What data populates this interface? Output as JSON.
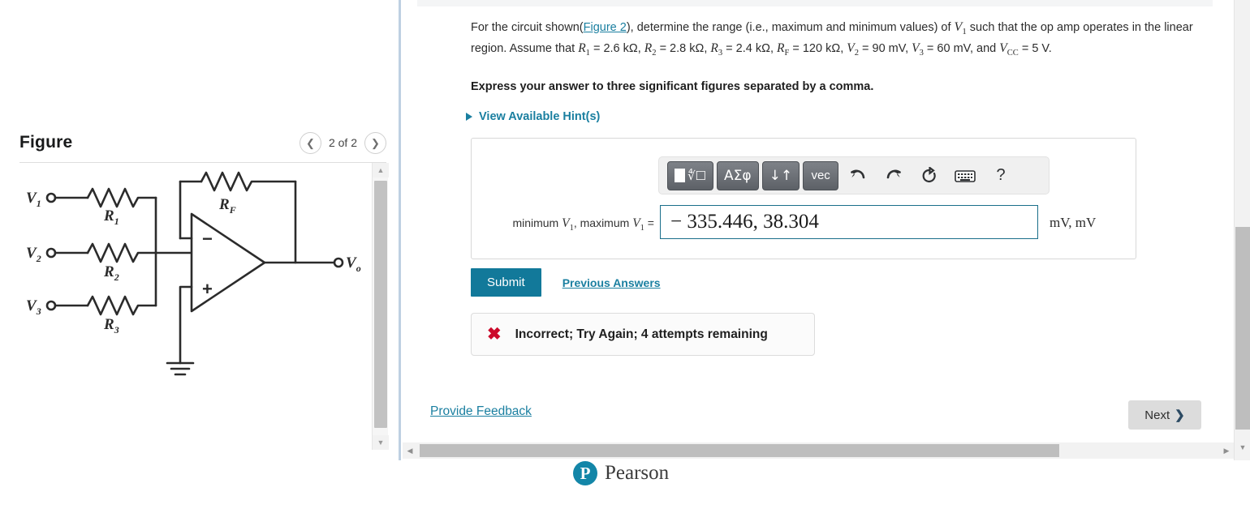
{
  "figure_panel": {
    "title": "Figure",
    "nav": {
      "prev_icon": "chevron-left-icon",
      "count": "2 of 2",
      "next_icon": "chevron-right-icon"
    },
    "circuit": {
      "alt": "summing op-amp circuit",
      "inputs": [
        "V1",
        "V2",
        "V3"
      ],
      "resistors": [
        "R1",
        "R2",
        "R3",
        "RF"
      ],
      "output": "Vo",
      "opamp_minus": "−",
      "opamp_plus": "+"
    }
  },
  "question": {
    "line1_a": "For the circuit shown(",
    "figure_link": "Figure 2",
    "line1_b": "), determine the range (i.e., maximum and minimum values) of ",
    "v1": "V",
    "v1_sub": "1",
    "line1_c": " such that the op amp operates in the linear region. Assume that ",
    "givens": [
      {
        "sym": "R",
        "sub": "1",
        "val": "= 2.6 kΩ"
      },
      {
        "sym": "R",
        "sub": "2",
        "val": "= 2.8 kΩ"
      },
      {
        "sym": "R",
        "sub": "3",
        "val": "= 2.4 kΩ"
      },
      {
        "sym": "R",
        "sub": "F",
        "val": "= 120 kΩ"
      },
      {
        "sym": "V",
        "sub": "2",
        "val": "= 90 mV"
      },
      {
        "sym": "V",
        "sub": "3",
        "val": "= 60 mV"
      },
      {
        "sym": "V",
        "sub": "CC",
        "val": "= 5 V"
      }
    ],
    "and_text": ", and ",
    "period": ".",
    "instruction": "Express your answer to three significant figures separated by a comma.",
    "hints_label": "View Available Hint(s)",
    "hints_icon": "triangle-right-icon"
  },
  "answer": {
    "toolbar": {
      "template_button": "template-icon",
      "greek_button": "ΑΣφ",
      "updown_button": "↓↑",
      "vec_button": "vec",
      "undo_icon": "↶",
      "redo_icon": "↷",
      "reset_icon": "⟳",
      "keyboard_icon": "⌨",
      "help_icon": "?"
    },
    "label_min": "minimum ",
    "label_v": "V",
    "label_sub": "1",
    "label_sep": ", maximum ",
    "label_eq": " =",
    "value": "− 335.446, 38.304",
    "placeholder": "",
    "units": "mV, mV"
  },
  "actions": {
    "submit_label": "Submit",
    "previous_answers_label": "Previous Answers"
  },
  "feedback": {
    "icon": "x-mark-icon",
    "message": "Incorrect; Try Again; 4 attempts remaining"
  },
  "footer": {
    "provide_feedback": "Provide Feedback",
    "next_label": "Next",
    "next_icon": "chevron-right-icon",
    "brand": "Pearson",
    "brand_mark": "P"
  },
  "colors": {
    "accent_teal": "#1a7fa0",
    "submit_teal": "#12799a",
    "error_red": "#cc0a2b",
    "divider_blue": "#bed0e2",
    "pearson_teal": "#1386a8"
  }
}
